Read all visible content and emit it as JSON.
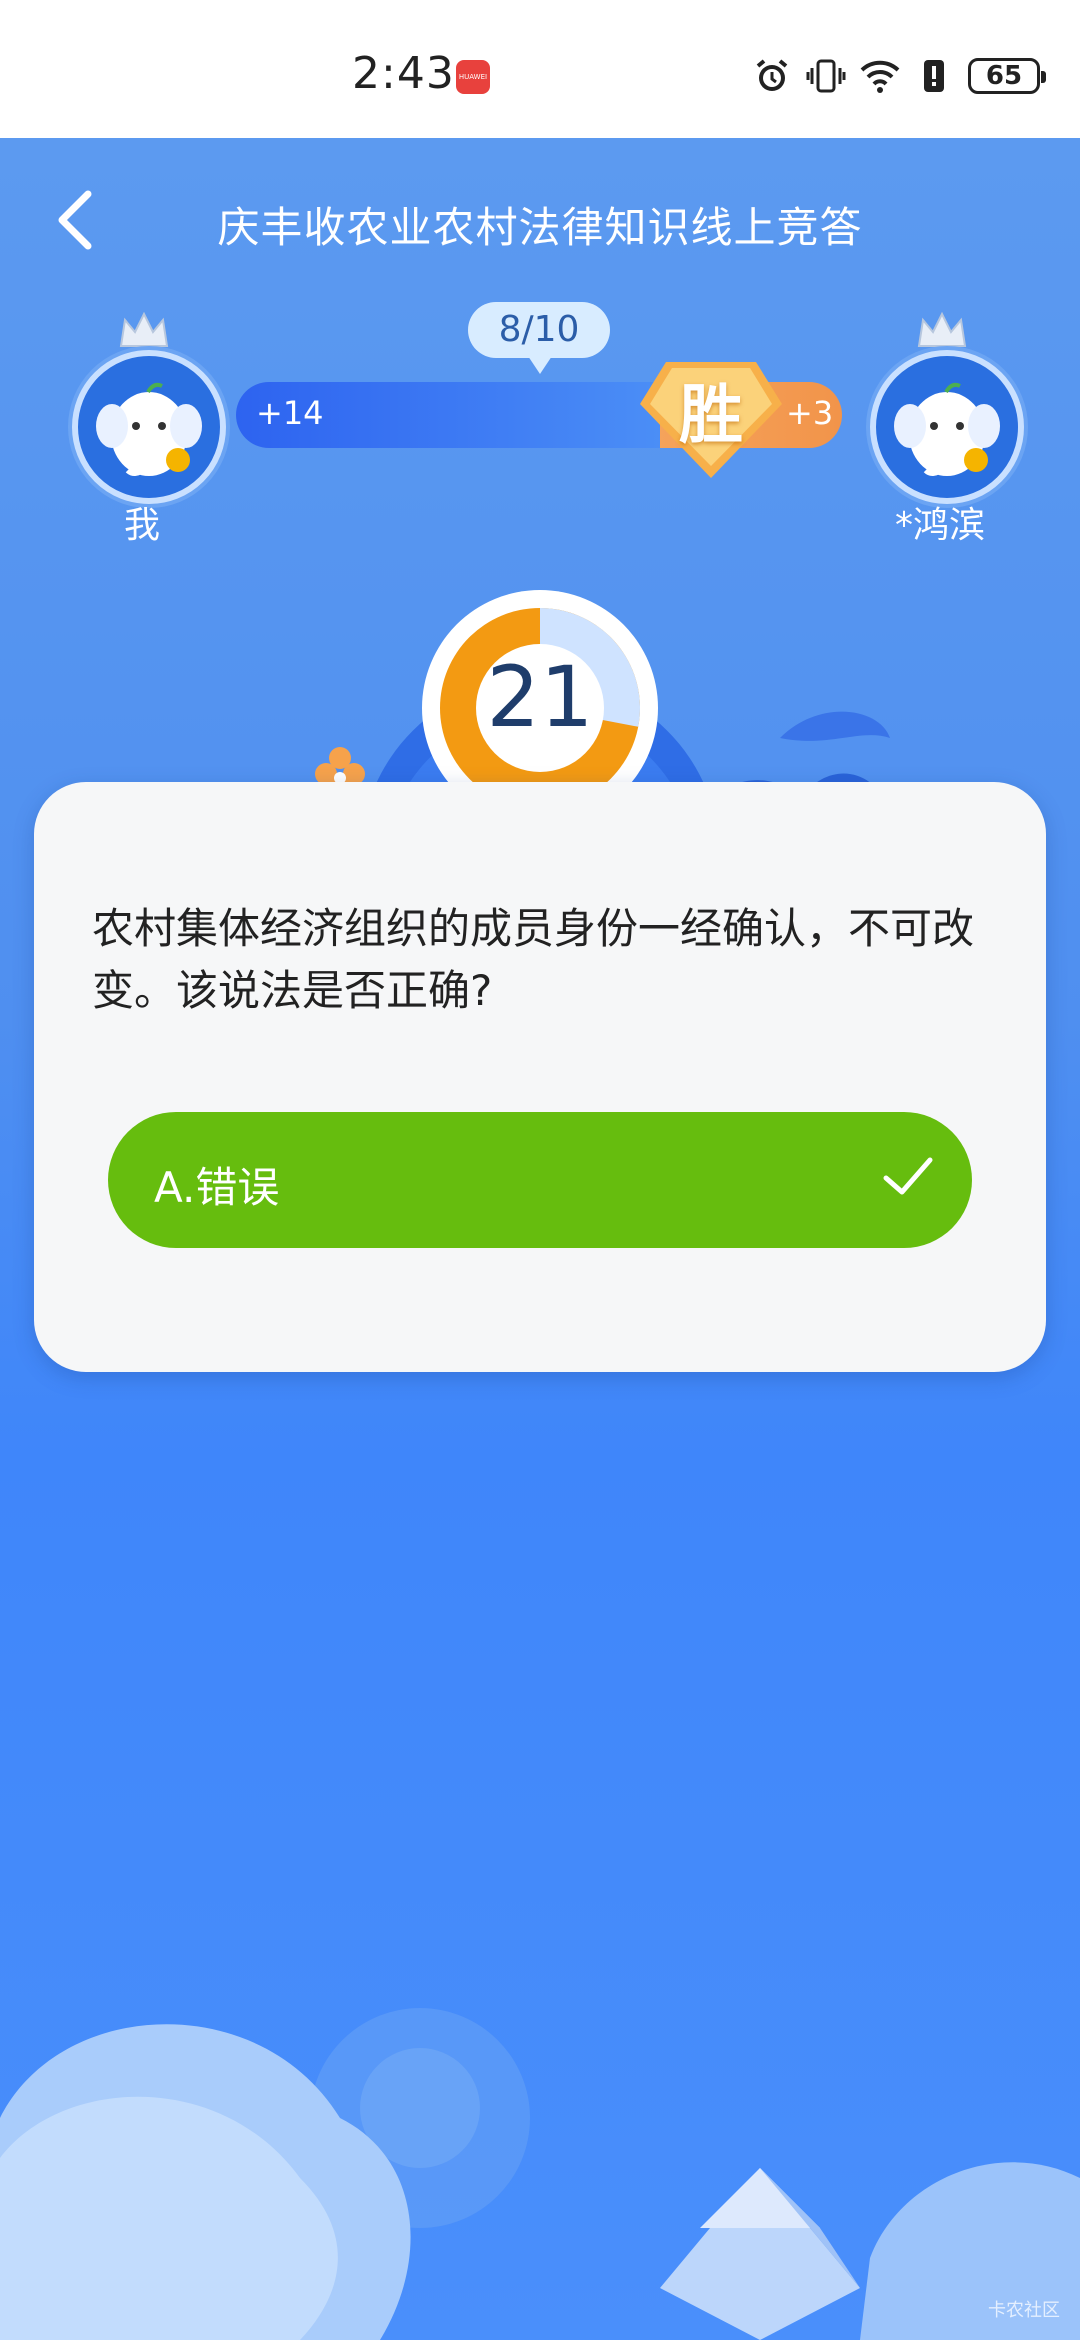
{
  "status_bar": {
    "time": "2:43",
    "app_badge": "HUAWEI",
    "battery": "65",
    "icons": [
      "alarm-icon",
      "vibrate-icon",
      "wifi-icon",
      "alert-battery-icon",
      "battery-icon"
    ]
  },
  "header": {
    "back_icon": "chevron-left-icon",
    "title": "庆丰收农业农村法律知识线上竞答"
  },
  "match": {
    "progress": "8/10",
    "player_left": {
      "name": "我",
      "score_delta": "+14"
    },
    "player_right": {
      "name": "*鸿滨",
      "score_delta": "+3"
    },
    "result_badge": "胜"
  },
  "timer": {
    "value": "21",
    "remaining_fraction": 0.28
  },
  "question": {
    "text": "农村集体经济组织的成员身份一经确认，不可改变。该说法是否正确?",
    "options": [
      {
        "label": "A.错误",
        "state": "correct"
      }
    ]
  },
  "watermark": "卡农社区",
  "colors": {
    "background": "#4f8ff0",
    "option_correct": "#66bd0e",
    "timer_orange": "#f39a12",
    "timer_light": "#cfe3ff"
  }
}
